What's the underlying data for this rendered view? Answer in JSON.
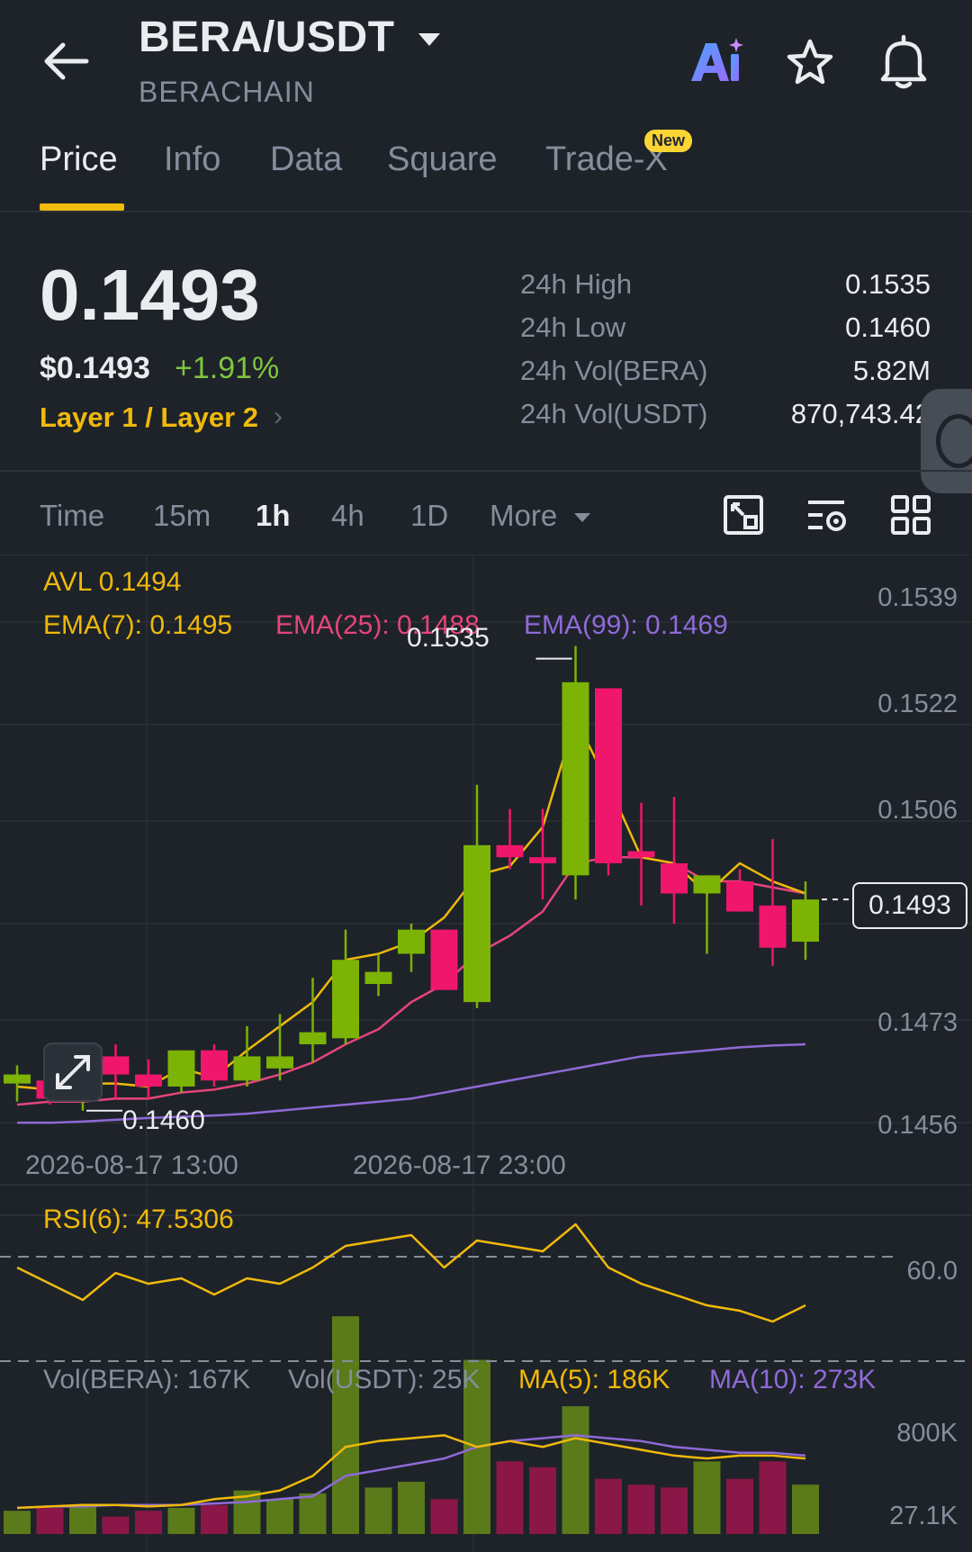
{
  "header": {
    "pair": "BERA/USDT",
    "subtitle": "BERACHAIN",
    "icons": [
      "back-arrow-icon",
      "dropdown-caret-icon",
      "ai-icon",
      "star-icon",
      "bell-icon"
    ]
  },
  "tabs": [
    {
      "label": "Price",
      "active": true
    },
    {
      "label": "Info"
    },
    {
      "label": "Data"
    },
    {
      "label": "Square"
    },
    {
      "label": "Trade-X",
      "badge": "New"
    }
  ],
  "price": {
    "last": "0.1493",
    "usd": "$0.1493",
    "change": "+1.91%",
    "tag": "Layer 1 / Layer 2"
  },
  "stats": [
    {
      "label": "24h High",
      "value": "0.1535"
    },
    {
      "label": "24h Low",
      "value": "0.1460"
    },
    {
      "label": "24h Vol(BERA)",
      "value": "5.82M"
    },
    {
      "label": "24h Vol(USDT)",
      "value": "870,743.42"
    }
  ],
  "intervals": [
    {
      "label": "Time"
    },
    {
      "label": "15m"
    },
    {
      "label": "1h",
      "active": true
    },
    {
      "label": "4h"
    },
    {
      "label": "1D"
    },
    {
      "label": "More"
    }
  ],
  "chart_tool_icons": [
    "fullscreen-chart-icon",
    "indicator-settings-icon",
    "layout-grid-icon"
  ],
  "indicators": {
    "avl": "AVL 0.1494",
    "ema7": "EMA(7): 0.1495",
    "ema25": "EMA(25): 0.1488",
    "ema99": "EMA(99): 0.1469",
    "high_marker": "0.1535",
    "low_marker": "0.1460",
    "current_price": "0.1493",
    "rsi": "RSI(6): 47.5306",
    "rsi_level": "60.0",
    "vol_bera": "Vol(BERA): 167K",
    "vol_usdt": "Vol(USDT): 25K",
    "vol_ma5": "MA(5): 186K",
    "vol_ma10": "MA(10): 273K",
    "vol_axis_top": "800K",
    "vol_axis_bottom": "27.1K"
  },
  "colors": {
    "up": "#7cb305",
    "down": "#f0166b",
    "accent": "#f0b90b",
    "ema25": "#e6457a",
    "ema99": "#8f6ad8"
  },
  "chart_data": {
    "type": "candlestick",
    "y_ticks": [
      "0.1539",
      "0.1522",
      "0.1506",
      "0.1473",
      "0.1456"
    ],
    "x_ticks": [
      "2026-08-17 13:00",
      "2026-08-17 23:00"
    ],
    "ylim": [
      0.1452,
      0.1543
    ],
    "candles": [
      {
        "o": 0.14625,
        "h": 0.14655,
        "l": 0.14595,
        "c": 0.1464
      },
      {
        "o": 0.1463,
        "h": 0.1464,
        "l": 0.1459,
        "c": 0.146
      },
      {
        "o": 0.1461,
        "h": 0.1469,
        "l": 0.1458,
        "c": 0.1463
      },
      {
        "o": 0.1467,
        "h": 0.1469,
        "l": 0.146,
        "c": 0.1464
      },
      {
        "o": 0.1464,
        "h": 0.14665,
        "l": 0.146,
        "c": 0.1462
      },
      {
        "o": 0.1462,
        "h": 0.1468,
        "l": 0.1461,
        "c": 0.1468
      },
      {
        "o": 0.1468,
        "h": 0.1469,
        "l": 0.1462,
        "c": 0.1463
      },
      {
        "o": 0.1463,
        "h": 0.1472,
        "l": 0.1462,
        "c": 0.1467
      },
      {
        "o": 0.1465,
        "h": 0.1474,
        "l": 0.1463,
        "c": 0.1467
      },
      {
        "o": 0.1469,
        "h": 0.148,
        "l": 0.1466,
        "c": 0.1471
      },
      {
        "o": 0.147,
        "h": 0.1488,
        "l": 0.1469,
        "c": 0.1483
      },
      {
        "o": 0.1479,
        "h": 0.1484,
        "l": 0.1477,
        "c": 0.1481
      },
      {
        "o": 0.1484,
        "h": 0.1489,
        "l": 0.1481,
        "c": 0.1488
      },
      {
        "o": 0.1488,
        "h": 0.1488,
        "l": 0.1481,
        "c": 0.1478
      },
      {
        "o": 0.1476,
        "h": 0.1512,
        "l": 0.1475,
        "c": 0.1502
      },
      {
        "o": 0.1502,
        "h": 0.1508,
        "l": 0.1498,
        "c": 0.15
      },
      {
        "o": 0.15,
        "h": 0.1508,
        "l": 0.1493,
        "c": 0.1499
      },
      {
        "o": 0.1497,
        "h": 0.1535,
        "l": 0.1493,
        "c": 0.1529
      },
      {
        "o": 0.1528,
        "h": 0.1528,
        "l": 0.1497,
        "c": 0.1499
      },
      {
        "o": 0.1501,
        "h": 0.1509,
        "l": 0.1492,
        "c": 0.15
      },
      {
        "o": 0.1499,
        "h": 0.151,
        "l": 0.1489,
        "c": 0.1494
      },
      {
        "o": 0.1494,
        "h": 0.1497,
        "l": 0.1484,
        "c": 0.1497
      },
      {
        "o": 0.1496,
        "h": 0.1498,
        "l": 0.1491,
        "c": 0.1491
      },
      {
        "o": 0.1492,
        "h": 0.1503,
        "l": 0.1482,
        "c": 0.1485
      },
      {
        "o": 0.1486,
        "h": 0.1496,
        "l": 0.1483,
        "c": 0.1493
      }
    ],
    "ema7": [
      0.1462,
      0.14615,
      0.14625,
      0.14625,
      0.1462,
      0.1465,
      0.14635,
      0.1468,
      0.1472,
      0.1476,
      0.1483,
      0.1484,
      0.1486,
      0.149,
      0.1497,
      0.14985,
      0.1505,
      0.1523,
      0.1512,
      0.15,
      0.1499,
      0.1494,
      0.1499,
      0.1496,
      0.1494
    ],
    "ema25": [
      0.1459,
      0.14595,
      0.14595,
      0.146,
      0.146,
      0.1461,
      0.14615,
      0.14625,
      0.1464,
      0.1466,
      0.1469,
      0.14715,
      0.1476,
      0.1479,
      0.1484,
      0.1487,
      0.1491,
      0.1499,
      0.15,
      0.15,
      0.1499,
      0.1496,
      0.1496,
      0.1495,
      0.1494
    ],
    "ema99": [
      0.1456,
      0.1456,
      0.14562,
      0.14565,
      0.14568,
      0.1457,
      0.14572,
      0.14575,
      0.1458,
      0.14585,
      0.1459,
      0.14595,
      0.146,
      0.1461,
      0.1462,
      0.1463,
      0.1464,
      0.1465,
      0.1466,
      0.1467,
      0.14675,
      0.1468,
      0.14685,
      0.14688,
      0.1469
    ],
    "rsi": [
      58,
      55,
      52,
      57,
      55,
      56,
      53,
      56,
      55,
      58,
      62,
      63,
      64,
      58,
      63,
      62,
      61,
      66,
      58,
      55,
      53,
      51,
      50,
      48,
      51
    ],
    "rsi_ylim": [
      40,
      70
    ],
    "volumes": [
      80,
      90,
      100,
      60,
      80,
      90,
      100,
      150,
      120,
      140,
      750,
      160,
      180,
      120,
      600,
      250,
      230,
      440,
      190,
      170,
      160,
      250,
      190,
      250,
      170
    ],
    "vol_ma5": [
      90,
      95,
      100,
      100,
      95,
      100,
      120,
      130,
      150,
      200,
      300,
      320,
      330,
      340,
      300,
      320,
      300,
      330,
      310,
      290,
      270,
      260,
      270,
      270,
      260
    ],
    "vol_ma10": [
      90,
      95,
      95,
      100,
      100,
      100,
      105,
      110,
      120,
      130,
      200,
      220,
      240,
      260,
      300,
      320,
      330,
      340,
      330,
      320,
      300,
      290,
      280,
      280,
      270
    ],
    "vol_ylim": [
      0,
      800
    ]
  }
}
